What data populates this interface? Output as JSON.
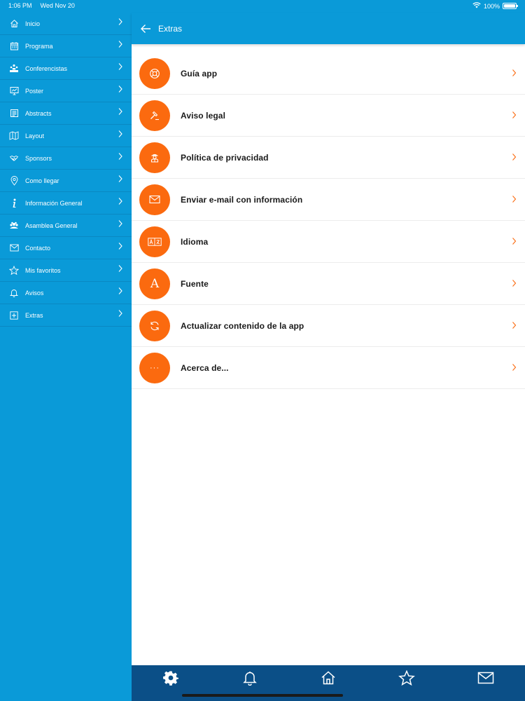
{
  "status": {
    "time": "1:06 PM",
    "date": "Wed Nov 20",
    "battery": "100%"
  },
  "sidebar": {
    "items": [
      {
        "label": "Inicio",
        "icon": "home-icon"
      },
      {
        "label": "Programa",
        "icon": "calendar-icon"
      },
      {
        "label": "Conferencistas",
        "icon": "speakers-icon"
      },
      {
        "label": "Poster",
        "icon": "poster-icon"
      },
      {
        "label": "Abstracts",
        "icon": "document-icon"
      },
      {
        "label": "Layout",
        "icon": "map-icon"
      },
      {
        "label": "Sponsors",
        "icon": "handshake-icon"
      },
      {
        "label": "Como llegar",
        "icon": "location-pin-icon"
      },
      {
        "label": "Información General",
        "icon": "info-icon"
      },
      {
        "label": "Asamblea General",
        "icon": "assembly-icon"
      },
      {
        "label": "Contacto",
        "icon": "envelope-icon"
      },
      {
        "label": "Mis favoritos",
        "icon": "star-icon"
      },
      {
        "label": "Avisos",
        "icon": "bell-icon"
      },
      {
        "label": "Extras",
        "icon": "plus-box-icon"
      }
    ]
  },
  "header": {
    "title": "Extras"
  },
  "main": {
    "items": [
      {
        "label": "Guía app",
        "icon": "lifebuoy-icon"
      },
      {
        "label": "Aviso legal",
        "icon": "gavel-icon"
      },
      {
        "label": "Política de privacidad",
        "icon": "privacy-agent-icon"
      },
      {
        "label": "Enviar e-mail con información",
        "icon": "envelope-icon"
      },
      {
        "label": "Idioma",
        "icon": "translate-icon"
      },
      {
        "label": "Fuente",
        "icon": "font-icon"
      },
      {
        "label": "Actualizar contenido de la app",
        "icon": "refresh-icon"
      },
      {
        "label": "Acerca de...",
        "icon": "ellipsis-icon"
      }
    ],
    "font_icon_glyph": "A",
    "ellipsis_glyph": "···"
  },
  "tabbar": {
    "tabs": [
      "settings-icon",
      "bell-icon",
      "home-icon",
      "star-icon",
      "envelope-icon"
    ]
  },
  "colors": {
    "primary": "#0a9ad8",
    "accent": "#fb6a0f",
    "tabbar": "#0b4f87"
  }
}
